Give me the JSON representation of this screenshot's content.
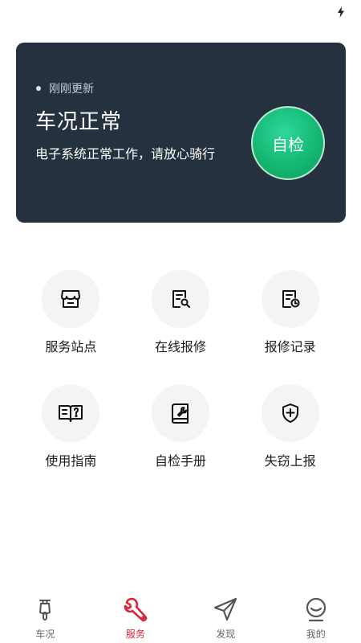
{
  "card": {
    "update_text": "刚刚更新",
    "title": "车况正常",
    "description": "电子系统正常工作，请放心骑行",
    "check_button": "自检"
  },
  "services": [
    {
      "label": "服务站点",
      "icon": "store-icon"
    },
    {
      "label": "在线报修",
      "icon": "repair-document-icon"
    },
    {
      "label": "报修记录",
      "icon": "record-history-icon"
    },
    {
      "label": "使用指南",
      "icon": "guide-book-icon"
    },
    {
      "label": "自检手册",
      "icon": "manual-book-icon"
    },
    {
      "label": "失窃上报",
      "icon": "shield-plus-icon"
    }
  ],
  "tabs": [
    {
      "label": "车况",
      "icon": "scooter-icon",
      "active": false
    },
    {
      "label": "服务",
      "icon": "wrench-icon",
      "active": true
    },
    {
      "label": "发现",
      "icon": "navigation-arrow-icon",
      "active": false
    },
    {
      "label": "我的",
      "icon": "smiley-profile-icon",
      "active": false
    }
  ],
  "colors": {
    "card_background": "#263140",
    "check_button": "#14b873",
    "active_tab": "#d6283a"
  }
}
